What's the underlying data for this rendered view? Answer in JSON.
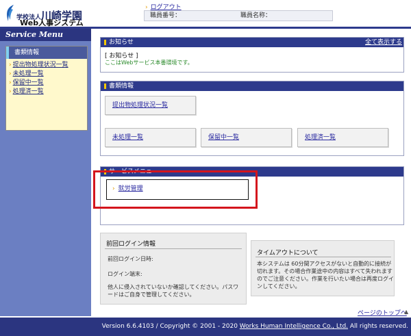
{
  "header": {
    "org_prefix": "学校法人",
    "org_name": "川崎学園",
    "system_name": "Web人事システム",
    "logout_label": "ログアウト",
    "employee_no_label": "職員番号：",
    "employee_name_label": "職員名称："
  },
  "sidebar": {
    "title": "Service Menu",
    "category": "書類情報",
    "items": [
      {
        "label": "提出物処理状況一覧"
      },
      {
        "label": "未処理一覧"
      },
      {
        "label": "保留中一覧"
      },
      {
        "label": "処理済一覧"
      }
    ]
  },
  "notice": {
    "header": "お知らせ",
    "show_all": "全て表示する",
    "title": "[ お知らせ ]",
    "body": "ここはWebサービス本番環境です。"
  },
  "documents": {
    "header": "書類情報",
    "buttons": [
      {
        "label": "提出物処理状況一覧"
      },
      {
        "label": "未処理一覧"
      },
      {
        "label": "保留中一覧"
      },
      {
        "label": "処理済一覧"
      }
    ]
  },
  "service": {
    "header": "サービスメニュー",
    "link": "就労管理"
  },
  "login_info": {
    "title": "前回ログイン情報",
    "last_login": "前回ログイン日時:",
    "terminal": "ログイン端末:",
    "warning": "他人に侵入されていないか確認してください。パスワードはご自身で管理してください。"
  },
  "timeout": {
    "title": "タイムアウトについて",
    "body": "本システムは 60分間アクセスがないと自動的に接続が切れます。その場合作業途中の内容はすべて失われますのでご注意ください。作業を行いたい場合は再度ログインしてください。"
  },
  "page_top": "ページのトップへ",
  "footer": {
    "text": "Version 6.6.4103 / Copyright © 2001 - 2020 ",
    "company": "Works Human Intelligence Co., Ltd.",
    "rights": " All rights reserved."
  },
  "colors": {
    "header_blue": "#2d3a8c",
    "sidebar_blue": "#6b7fc2",
    "highlight_red": "#d4151d",
    "accent_yellow": "#f5c700"
  }
}
